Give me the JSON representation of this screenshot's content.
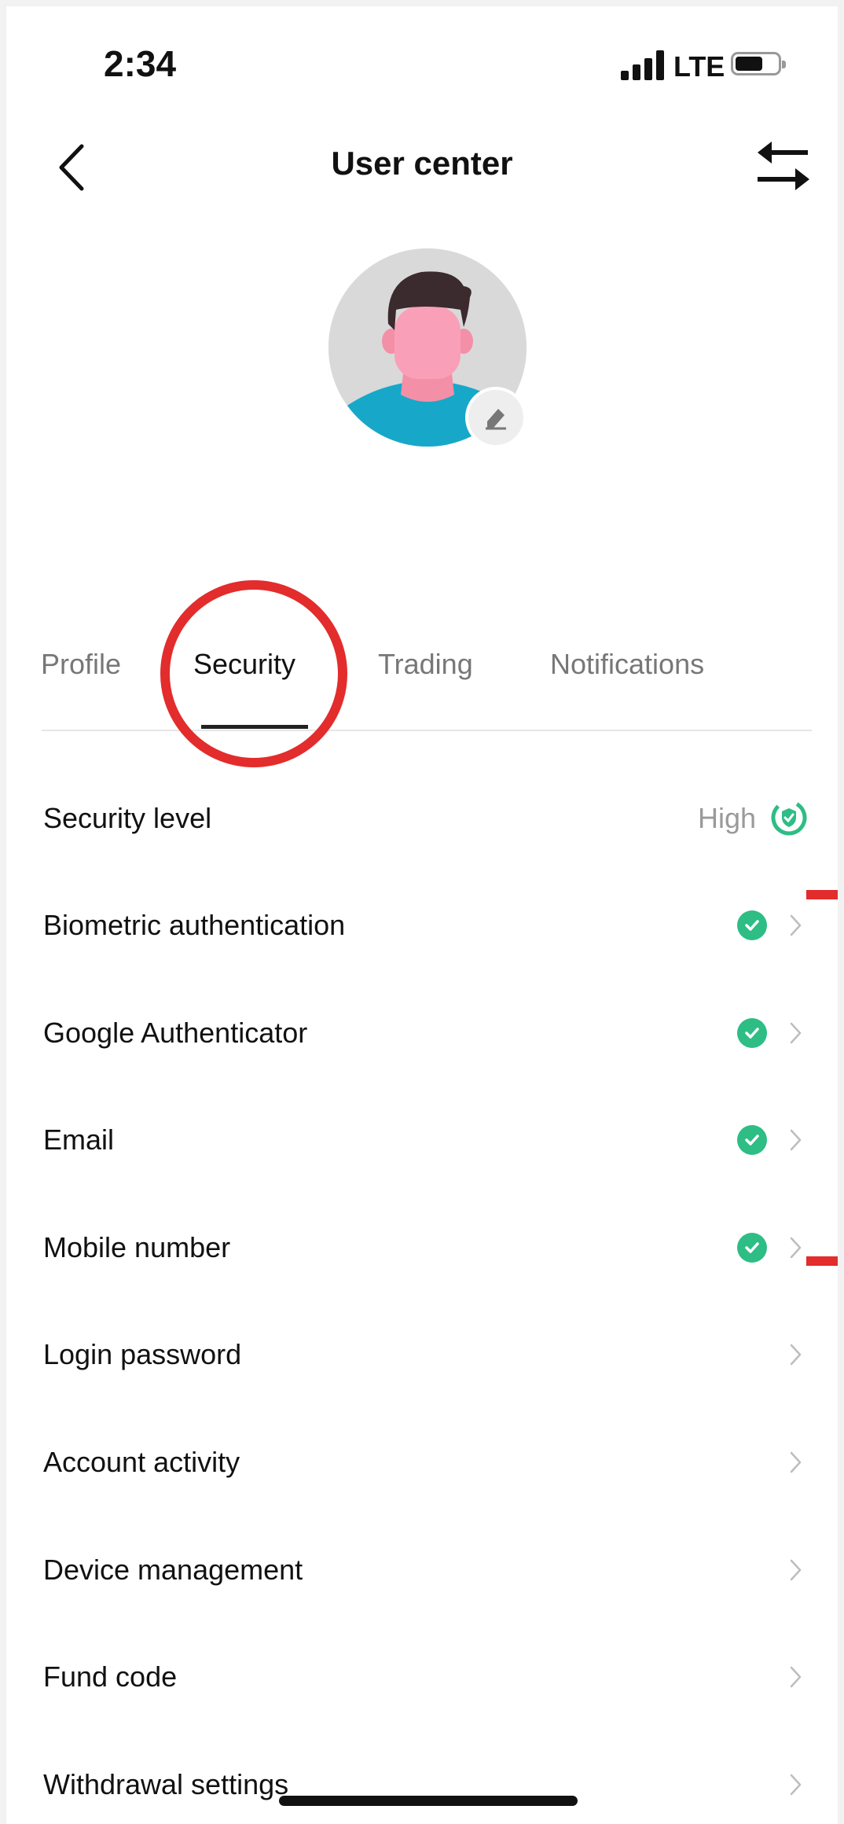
{
  "status_bar": {
    "time": "2:34",
    "network": "LTE",
    "battery_level": 0.65
  },
  "header": {
    "title": "User center",
    "back_icon": "chevron-left-icon",
    "action_icon": "swap-arrows-icon"
  },
  "avatar": {
    "edit_icon": "eraser-edit-icon"
  },
  "tabs": [
    {
      "label": "Profile",
      "active": false
    },
    {
      "label": "Security",
      "active": true
    },
    {
      "label": "Trading",
      "active": false
    },
    {
      "label": "Notifications",
      "active": false
    }
  ],
  "security_level": {
    "label": "Security level",
    "value": "High",
    "icon": "shield-check-icon"
  },
  "items": [
    {
      "label": "Biometric authentication",
      "verified": true
    },
    {
      "label": "Google Authenticator",
      "verified": true
    },
    {
      "label": "Email",
      "verified": true
    },
    {
      "label": "Mobile number",
      "verified": true
    },
    {
      "label": "Login password",
      "verified": false
    },
    {
      "label": "Account activity",
      "verified": false
    },
    {
      "label": "Device management",
      "verified": false
    },
    {
      "label": "Fund code",
      "verified": false
    },
    {
      "label": "Withdrawal settings",
      "verified": false
    }
  ],
  "colors": {
    "accent_green": "#2ebd85",
    "annotation_red": "#e32c2c",
    "text_primary": "#111111",
    "text_secondary": "#777777"
  }
}
